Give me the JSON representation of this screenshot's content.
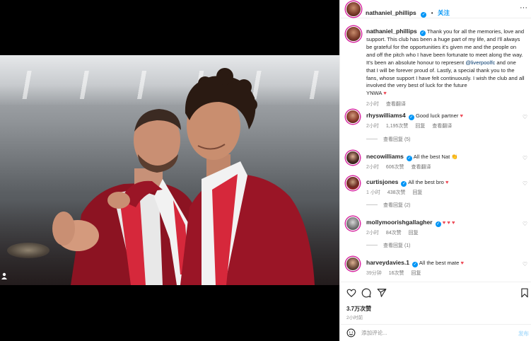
{
  "post": {
    "author": "nathaniel_phillips",
    "follow_label": "关注",
    "more_label": "···",
    "caption": {
      "username": "nathaniel_phillips",
      "text_before_mention": "Thank you for all the memories, love and support. This club has been a huge part of my life, and I'll always be grateful for the opportunities it's given me and the people on and off the pitch who I have been fortunate to meet along the way. It's been an absolute honour to represent ",
      "mention": "@liverpoolfc",
      "text_after_mention": " and one that I will be forever proud of. Lastly, a special thank you to the fans, whose support I have felt continuously. I wish the club and all involved the very best of luck for the future",
      "signoff": "YNWA",
      "signoff_emoji": "♥",
      "time": "2小时",
      "translate": "查看翻译"
    },
    "comments": [
      {
        "username": "rhyswilliams4",
        "text": "Good luck partner",
        "emoji": "♥",
        "time": "2小时",
        "likes": "1,195次赞",
        "reply": "回复",
        "translate": "查看翻译",
        "view_replies": "查看回复 (5)"
      },
      {
        "username": "necowilliams",
        "text": "All the best Nat",
        "emoji": "👏",
        "time": "2小时",
        "likes": "606次赞",
        "reply": "",
        "translate": "查看翻译",
        "view_replies": ""
      },
      {
        "username": "curtisjones",
        "text": "All the best bro",
        "emoji": "♥",
        "time": "1 小时",
        "likes": "438次赞",
        "reply": "回复",
        "translate": "",
        "view_replies": "查看回复 (2)"
      },
      {
        "username": "mollymoorishgallagher",
        "text": "",
        "emoji": "♥ ♥ ♥",
        "time": "2小时",
        "likes": "84次赞",
        "reply": "回复",
        "translate": "",
        "view_replies": "查看回复 (1)"
      },
      {
        "username": "harveydavies.1",
        "text": "All the best mate",
        "emoji": "♥",
        "time": "39分钟",
        "likes": "16次赞",
        "reply": "回复",
        "translate": "",
        "view_replies": ""
      }
    ],
    "like_count": "3.7万次赞",
    "posted_time": "2小时前",
    "comment_placeholder": "添加评论...",
    "post_button": "发布"
  },
  "icons": {
    "like": "heart-outline-icon",
    "comment": "comment-icon",
    "share": "share-icon",
    "save": "bookmark-icon",
    "emoji": "emoji-icon",
    "tag": "user-tag-icon"
  },
  "colors": {
    "link": "#0095f6",
    "mention": "#00376b",
    "heart": "#ed4956",
    "muted": "#8e8e8e"
  }
}
